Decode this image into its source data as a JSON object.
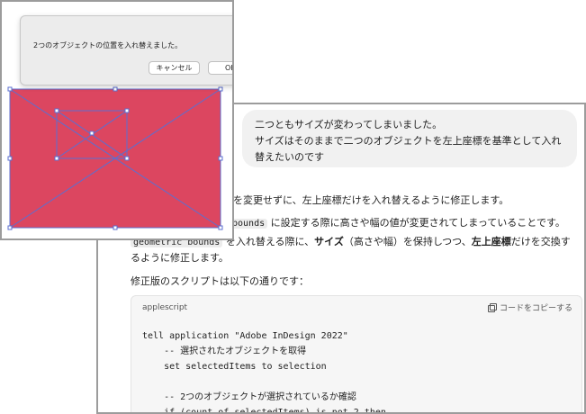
{
  "dialog": {
    "message": "2つのオブジェクトの位置を入れ替えました。",
    "cancel_label": "キャンセル",
    "ok_label": "OK"
  },
  "canvas": {
    "fill_color": "#dc4660",
    "frame_color": "#5b6fd0"
  },
  "chat": {
    "user_message": {
      "line1": "二つともサイズが変わってしまいました。",
      "line2": "サイズはそのままで二つのオブジェクトを左上座標を基準として入れ",
      "line3": "替えたいのです"
    },
    "response": {
      "line1": "を変更せずに、左上座標だけを入れ替えるように修正します。",
      "line2_code": "bounds",
      "line2_text": "に設定する際に高さや幅の値が変更されてしまっていることです。",
      "line3_code": "geometric bounds",
      "line3_pre": "を入れ替える際に、",
      "line3_bold1": "サイズ",
      "line3_mid": "（高さや幅）を保持しつつ、",
      "line3_bold2": "左上座標",
      "line3_post": "だけを交換す",
      "line4": "るように修正します。",
      "line5": "修正版のスクリプトは以下の通りです："
    },
    "code_block": {
      "language": "applescript",
      "copy_label": "コードをコピーする",
      "lines": [
        "tell application \"Adobe InDesign 2022\"",
        "    -- 選択されたオブジェクトを取得",
        "    set selectedItems to selection",
        "",
        "    -- 2つのオブジェクトが選択されているか確認",
        "    if (count of selectedItems) is not 2 then"
      ]
    }
  }
}
